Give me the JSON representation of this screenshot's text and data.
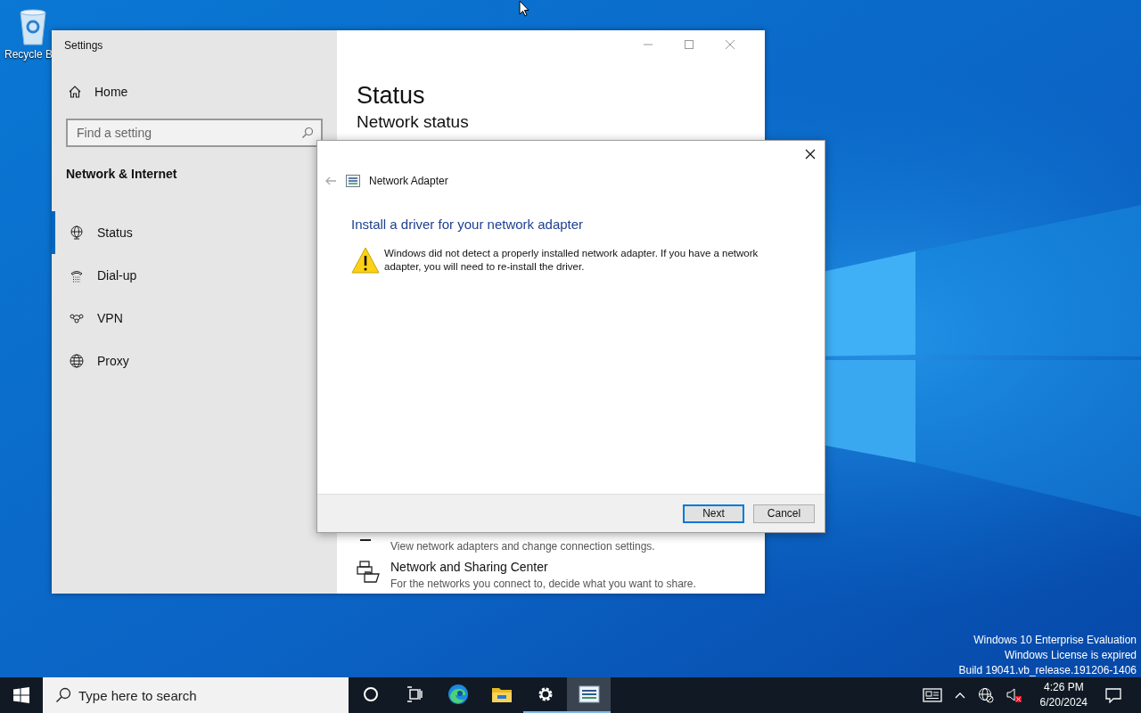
{
  "desktop": {
    "icons": [
      {
        "label": "Recycle B"
      }
    ],
    "watermark": [
      "Windows 10 Enterprise Evaluation",
      "Windows License is expired",
      "Build 19041.vb_release.191206-1406"
    ]
  },
  "settings_window": {
    "title": "Settings",
    "home": "Home",
    "search": {
      "placeholder": "Find a setting"
    },
    "section": "Network & Internet",
    "nav": [
      {
        "label": "Status",
        "kind": "status",
        "selected": true
      },
      {
        "label": "Dial-up",
        "kind": "dialup",
        "selected": false
      },
      {
        "label": "VPN",
        "kind": "vpn",
        "selected": false
      },
      {
        "label": "Proxy",
        "kind": "proxy",
        "selected": false
      }
    ],
    "page_title": "Status",
    "heading": "Network status",
    "links": [
      {
        "description": "View network adapters and change connection settings."
      },
      {
        "title": "Network and Sharing Center",
        "description": "For the networks you connect to, decide what you want to share."
      }
    ]
  },
  "dialog": {
    "title": "Network Adapter",
    "heading": "Install a driver for your network adapter",
    "message": "Windows did not detect a properly installed network adapter. If you have a network adapter, you will need to re-install the driver.",
    "buttons": [
      {
        "label": "Next",
        "default": true
      },
      {
        "label": "Cancel",
        "default": false
      }
    ]
  },
  "taskbar": {
    "search": {
      "placeholder": "Type here to search"
    },
    "apps": [
      {
        "kind": "cortana",
        "running": false,
        "selected": false
      },
      {
        "kind": "taskview",
        "running": false,
        "selected": false
      },
      {
        "kind": "edge",
        "running": false,
        "selected": false
      },
      {
        "kind": "explorer",
        "running": false,
        "selected": false
      },
      {
        "kind": "settings",
        "running": true,
        "selected": false
      },
      {
        "kind": "adapter",
        "running": true,
        "selected": true
      }
    ],
    "time": "4:26 PM",
    "date": "6/20/2024"
  }
}
